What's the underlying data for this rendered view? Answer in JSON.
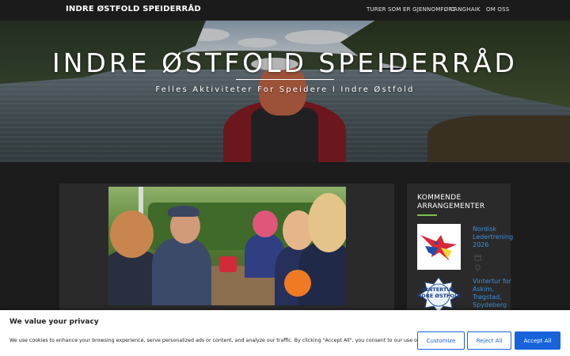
{
  "header": {
    "site_title": "INDRE ØSTFOLD SPEIDERRÅD",
    "nav": [
      "TURER SOM ER GJENNOMFØRT",
      "LANGHAIK",
      "OM OSS"
    ]
  },
  "hero": {
    "title": "INDRE ØSTFOLD SPEIDERRÅD",
    "subtitle": "Felles Aktiviteter For Speidere I Indre Østfold"
  },
  "sidebar": {
    "title": "KOMMENDE ARRANGEMENTER",
    "events": [
      {
        "title": "Nordisk Ledertrening 2026",
        "icon": "calendar-icon"
      },
      {
        "title": "Vintertur for Askim, Trøgstad, Spydeberg",
        "badge_text": "VINTERTUR INDRE ØSTFOLD"
      }
    ]
  },
  "cookie": {
    "title": "We value your privacy",
    "text": "We use cookies to enhance your browsing experience, serve personalized ads or content, and analyze our traffic. By clicking \"Accept All\", you consent to our use of cookies.",
    "customize": "Customize",
    "reject": "Reject All",
    "accept": "Accept All"
  },
  "colors": {
    "accent_link": "#3b8fd9",
    "accent_rule": "#7bbf4e",
    "button_primary": "#1863dc",
    "nav_background": "#1b1b1b"
  }
}
